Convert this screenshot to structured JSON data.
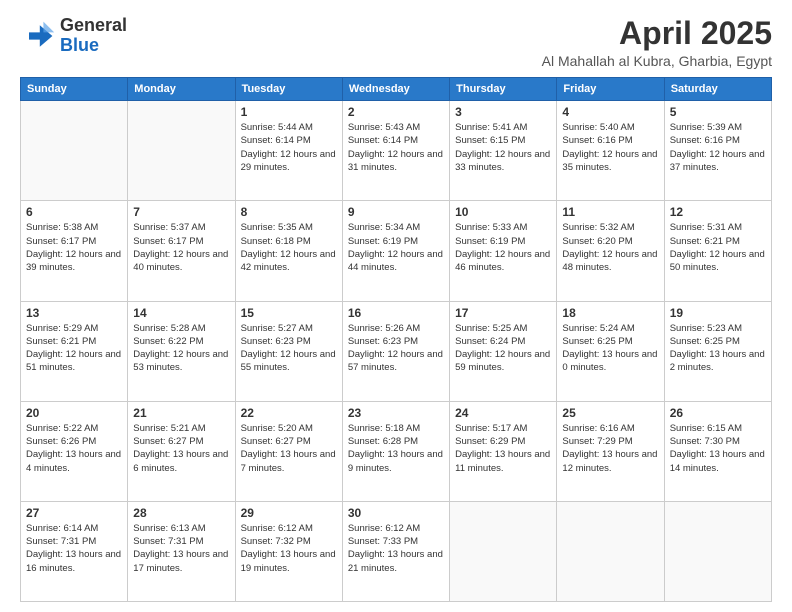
{
  "logo": {
    "general": "General",
    "blue": "Blue"
  },
  "title": "April 2025",
  "subtitle": "Al Mahallah al Kubra, Gharbia, Egypt",
  "weekdays": [
    "Sunday",
    "Monday",
    "Tuesday",
    "Wednesday",
    "Thursday",
    "Friday",
    "Saturday"
  ],
  "weeks": [
    [
      {
        "day": "",
        "info": ""
      },
      {
        "day": "",
        "info": ""
      },
      {
        "day": "1",
        "info": "Sunrise: 5:44 AM\nSunset: 6:14 PM\nDaylight: 12 hours and 29 minutes."
      },
      {
        "day": "2",
        "info": "Sunrise: 5:43 AM\nSunset: 6:14 PM\nDaylight: 12 hours and 31 minutes."
      },
      {
        "day": "3",
        "info": "Sunrise: 5:41 AM\nSunset: 6:15 PM\nDaylight: 12 hours and 33 minutes."
      },
      {
        "day": "4",
        "info": "Sunrise: 5:40 AM\nSunset: 6:16 PM\nDaylight: 12 hours and 35 minutes."
      },
      {
        "day": "5",
        "info": "Sunrise: 5:39 AM\nSunset: 6:16 PM\nDaylight: 12 hours and 37 minutes."
      }
    ],
    [
      {
        "day": "6",
        "info": "Sunrise: 5:38 AM\nSunset: 6:17 PM\nDaylight: 12 hours and 39 minutes."
      },
      {
        "day": "7",
        "info": "Sunrise: 5:37 AM\nSunset: 6:17 PM\nDaylight: 12 hours and 40 minutes."
      },
      {
        "day": "8",
        "info": "Sunrise: 5:35 AM\nSunset: 6:18 PM\nDaylight: 12 hours and 42 minutes."
      },
      {
        "day": "9",
        "info": "Sunrise: 5:34 AM\nSunset: 6:19 PM\nDaylight: 12 hours and 44 minutes."
      },
      {
        "day": "10",
        "info": "Sunrise: 5:33 AM\nSunset: 6:19 PM\nDaylight: 12 hours and 46 minutes."
      },
      {
        "day": "11",
        "info": "Sunrise: 5:32 AM\nSunset: 6:20 PM\nDaylight: 12 hours and 48 minutes."
      },
      {
        "day": "12",
        "info": "Sunrise: 5:31 AM\nSunset: 6:21 PM\nDaylight: 12 hours and 50 minutes."
      }
    ],
    [
      {
        "day": "13",
        "info": "Sunrise: 5:29 AM\nSunset: 6:21 PM\nDaylight: 12 hours and 51 minutes."
      },
      {
        "day": "14",
        "info": "Sunrise: 5:28 AM\nSunset: 6:22 PM\nDaylight: 12 hours and 53 minutes."
      },
      {
        "day": "15",
        "info": "Sunrise: 5:27 AM\nSunset: 6:23 PM\nDaylight: 12 hours and 55 minutes."
      },
      {
        "day": "16",
        "info": "Sunrise: 5:26 AM\nSunset: 6:23 PM\nDaylight: 12 hours and 57 minutes."
      },
      {
        "day": "17",
        "info": "Sunrise: 5:25 AM\nSunset: 6:24 PM\nDaylight: 12 hours and 59 minutes."
      },
      {
        "day": "18",
        "info": "Sunrise: 5:24 AM\nSunset: 6:25 PM\nDaylight: 13 hours and 0 minutes."
      },
      {
        "day": "19",
        "info": "Sunrise: 5:23 AM\nSunset: 6:25 PM\nDaylight: 13 hours and 2 minutes."
      }
    ],
    [
      {
        "day": "20",
        "info": "Sunrise: 5:22 AM\nSunset: 6:26 PM\nDaylight: 13 hours and 4 minutes."
      },
      {
        "day": "21",
        "info": "Sunrise: 5:21 AM\nSunset: 6:27 PM\nDaylight: 13 hours and 6 minutes."
      },
      {
        "day": "22",
        "info": "Sunrise: 5:20 AM\nSunset: 6:27 PM\nDaylight: 13 hours and 7 minutes."
      },
      {
        "day": "23",
        "info": "Sunrise: 5:18 AM\nSunset: 6:28 PM\nDaylight: 13 hours and 9 minutes."
      },
      {
        "day": "24",
        "info": "Sunrise: 5:17 AM\nSunset: 6:29 PM\nDaylight: 13 hours and 11 minutes."
      },
      {
        "day": "25",
        "info": "Sunrise: 6:16 AM\nSunset: 7:29 PM\nDaylight: 13 hours and 12 minutes."
      },
      {
        "day": "26",
        "info": "Sunrise: 6:15 AM\nSunset: 7:30 PM\nDaylight: 13 hours and 14 minutes."
      }
    ],
    [
      {
        "day": "27",
        "info": "Sunrise: 6:14 AM\nSunset: 7:31 PM\nDaylight: 13 hours and 16 minutes."
      },
      {
        "day": "28",
        "info": "Sunrise: 6:13 AM\nSunset: 7:31 PM\nDaylight: 13 hours and 17 minutes."
      },
      {
        "day": "29",
        "info": "Sunrise: 6:12 AM\nSunset: 7:32 PM\nDaylight: 13 hours and 19 minutes."
      },
      {
        "day": "30",
        "info": "Sunrise: 6:12 AM\nSunset: 7:33 PM\nDaylight: 13 hours and 21 minutes."
      },
      {
        "day": "",
        "info": ""
      },
      {
        "day": "",
        "info": ""
      },
      {
        "day": "",
        "info": ""
      }
    ]
  ]
}
